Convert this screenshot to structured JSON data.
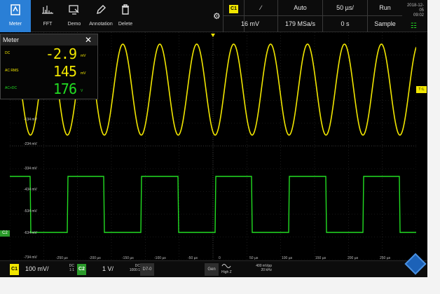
{
  "toolbar": {
    "tools": [
      {
        "label": "Meter",
        "icon": "meter-icon"
      },
      {
        "label": "FFT",
        "icon": "fft-icon"
      },
      {
        "label": "Demo",
        "icon": "demo-icon"
      },
      {
        "label": "Annotation",
        "icon": "pencil-icon"
      },
      {
        "label": "Delete",
        "icon": "trash-icon"
      }
    ]
  },
  "settings": {
    "channel": "C1",
    "slope": "∕",
    "trigger_level": "16 mV",
    "trigger_mode": "Auto",
    "sample_rate": "179 MSa/s",
    "timebase": "50 µs/",
    "offset": "0 s",
    "run_state": "Run",
    "acquisition": "Sample"
  },
  "clock": {
    "date": "2018-12-05",
    "time": "09:02"
  },
  "meter": {
    "title": "Meter",
    "rows": [
      {
        "name": "DC",
        "value": "-2.9",
        "unit": "mV"
      },
      {
        "name": "AC RMS",
        "value": "145",
        "unit": "mV"
      },
      {
        "name": "AC+DC",
        "value": "176",
        "unit": "V"
      }
    ]
  },
  "y_labels": [
    "-134 mV",
    "-234 mV",
    "-334 mV",
    "-434 mV",
    "-534 mV",
    "-634 mV",
    "-734 mV"
  ],
  "x_labels": [
    "-250 µs",
    "-200 µs",
    "-150 µs",
    "-100 µs",
    "-50 µs",
    "0",
    "50 µs",
    "100 µs",
    "150 µs",
    "200 µs",
    "250 µs"
  ],
  "trigger_tag": "T↑L",
  "c2_marker": "C2",
  "bottom": {
    "c1_badge": "C1",
    "c1_scale": "100 mV/",
    "c1_coupling": "DC",
    "c1_probe": "1:1",
    "c2_badge": "C2",
    "c2_scale": "1 V/",
    "c2_coupling": "DC",
    "c2_probe": "1000:1",
    "digital": "D7-0",
    "gen": "Gen",
    "gen_wave_label": "High Z",
    "gen_amplitude": "400 mVpp",
    "gen_freq": "20 kHz"
  },
  "colors": {
    "channel1": "#f1e600",
    "channel2": "#22dd22",
    "accent": "#2a7fd6"
  },
  "chart_data": {
    "type": "line",
    "series": [
      {
        "name": "C1",
        "shape": "sine",
        "cycles": 11.0
      },
      {
        "name": "C2",
        "shape": "square",
        "cycles": 5.5
      }
    ]
  }
}
